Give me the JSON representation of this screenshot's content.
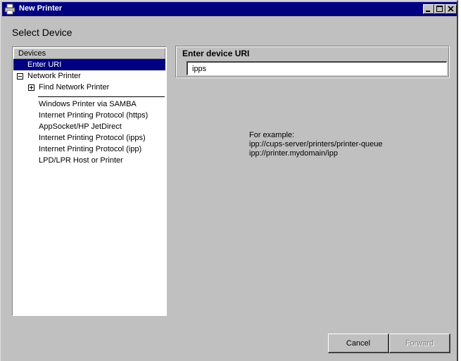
{
  "window": {
    "title": "New Printer",
    "heading": "Select Device"
  },
  "devices": {
    "header": "Devices",
    "items": [
      {
        "label": "Enter URI",
        "selected": true
      },
      {
        "label": "Network Printer",
        "expander": "minus"
      },
      {
        "label": "Find Network Printer",
        "expander": "plus"
      },
      {
        "label": "Windows Printer via SAMBA"
      },
      {
        "label": "Internet Printing Protocol (https)"
      },
      {
        "label": "AppSocket/HP JetDirect"
      },
      {
        "label": "Internet Printing Protocol (ipps)"
      },
      {
        "label": "Internet Printing Protocol (ipp)"
      },
      {
        "label": "LPD/LPR Host or Printer"
      }
    ]
  },
  "uri": {
    "label": "Enter device URI",
    "value": "ipps"
  },
  "example": {
    "line1": "For example:",
    "line2": "ipp://cups-server/printers/printer-queue",
    "line3": "ipp://printer.mydomain/ipp"
  },
  "buttons": {
    "cancel": "Cancel",
    "forward": "Forward"
  },
  "colors": {
    "titlebar": "#000080",
    "selection": "#000080",
    "face": "#c0c0c0"
  }
}
